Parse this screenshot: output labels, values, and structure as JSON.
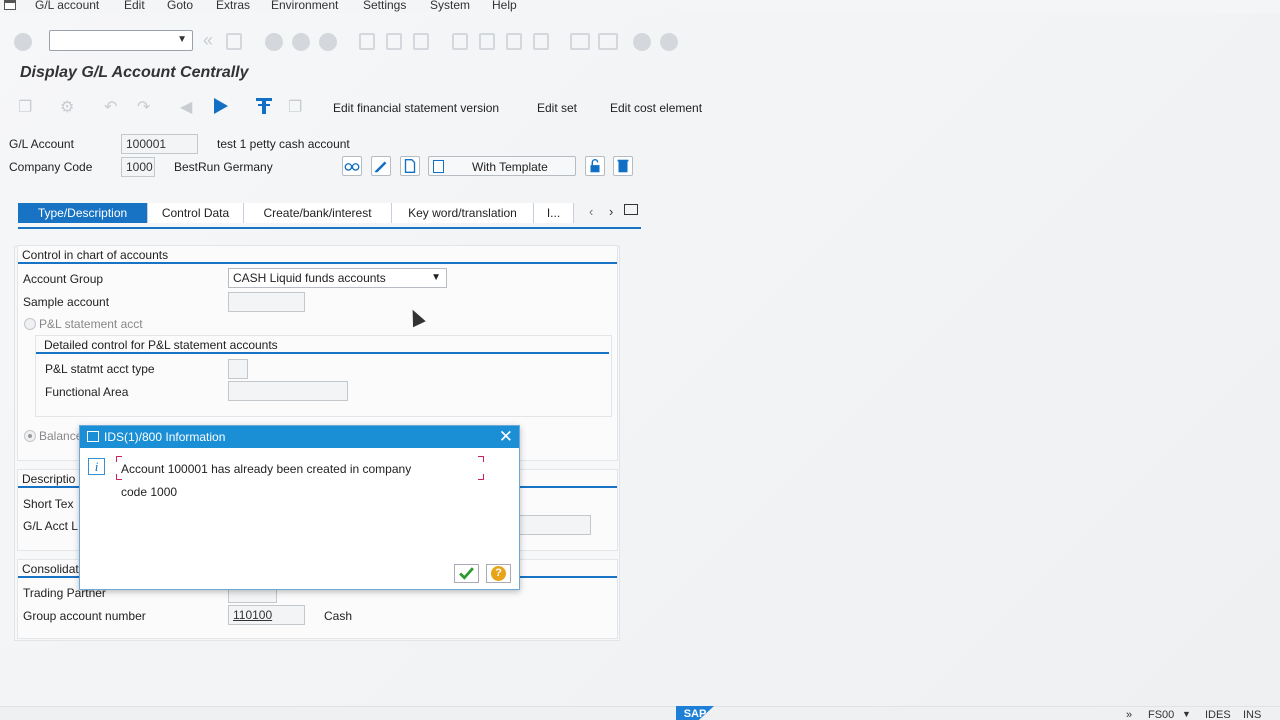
{
  "menu": [
    {
      "label": "G/L account"
    },
    {
      "label": "Edit"
    },
    {
      "label": "Goto"
    },
    {
      "label": "Extras"
    },
    {
      "label": "Environment"
    },
    {
      "label": "Settings"
    },
    {
      "label": "System"
    },
    {
      "label": "Help"
    }
  ],
  "command_field": {
    "value": ""
  },
  "page_title": "Display G/L Account Centrally",
  "app_toolbar": {
    "fs_version": "Edit financial statement version",
    "edit_set": "Edit set",
    "edit_cost": "Edit cost element"
  },
  "header": {
    "gl_label": "G/L Account",
    "gl_value": "100001",
    "gl_desc": "test 1 petty cash account",
    "cc_label": "Company Code",
    "cc_value": "1000",
    "cc_desc": "BestRun Germany",
    "template_label": "With Template"
  },
  "tabs": [
    {
      "label": "Type/Description",
      "active": true
    },
    {
      "label": "Control Data"
    },
    {
      "label": "Create/bank/interest"
    },
    {
      "label": "Key word/translation"
    },
    {
      "label": "I..."
    }
  ],
  "coa_group": {
    "title": "Control in chart of accounts",
    "account_group_label": "Account Group",
    "account_group_value": "CASH Liquid funds accounts",
    "sample_label": "Sample account",
    "pl_label": "P&L statement acct",
    "detail_title": "Detailed control for P&L statement accounts",
    "pl_type_label": "P&L statmt acct type",
    "func_area_label": "Functional Area",
    "balance_label": "Balance"
  },
  "desc_group": {
    "title": "Descriptio",
    "short_text_label": "Short Tex",
    "long_text_label": "G/L Acct L"
  },
  "consol_group": {
    "title": "Consolidat",
    "trading_partner_label": "Trading Partner",
    "group_account_label": "Group account number",
    "group_account_value": "110100",
    "group_account_desc": "Cash"
  },
  "dialog": {
    "title": "IDS(1)/800 Information",
    "message_line1": "Account 100001 has already been created in company",
    "message_line2": "code 1000"
  },
  "status": {
    "logo": "SAP",
    "arrows": "»",
    "transaction": "FS00",
    "system": "IDES",
    "mode": "INS"
  },
  "colors": {
    "accent": "#1873c5",
    "dialog_title": "#1a8fd6",
    "help": "#e8a317",
    "ok": "#2e9a2e"
  }
}
